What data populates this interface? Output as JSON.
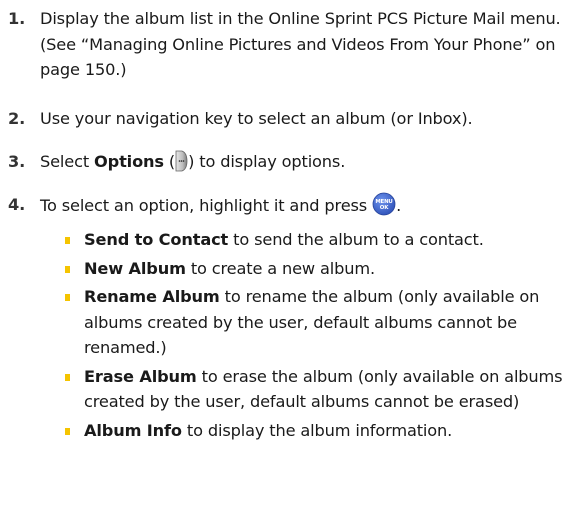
{
  "steps": [
    {
      "number": "1.",
      "text": "Display the album list in the Online Sprint PCS Picture Mail menu. (See “Managing Online Pictures and Videos From Your Phone” on page 150.)"
    },
    {
      "number": "2.",
      "text": "Use your navigation key to select an album (or Inbox)."
    },
    {
      "number": "3.",
      "prefix": "Select ",
      "bold": "Options",
      "middle": " (",
      "icon": "options-softkey-icon",
      "suffix": ") to display options."
    },
    {
      "number": "4.",
      "prefix": "To select an option, highlight it and press ",
      "icon": "menu-ok-key-icon",
      "icon_text_top": "MENU",
      "icon_text_bottom": "OK",
      "suffix": "."
    }
  ],
  "options": [
    {
      "term": "Send to Contact",
      "desc": " to send the album to a contact."
    },
    {
      "term": "New Album",
      "desc": " to create a new album."
    },
    {
      "term": "Rename Album",
      "desc": " to rename the album (only available on albums created by the user, default albums cannot be renamed.)"
    },
    {
      "term": "Erase Album",
      "desc": " to erase the album (only available on albums created by the user, default albums cannot be erased)"
    },
    {
      "term": "Album Info",
      "desc": " to display the album information."
    }
  ],
  "colors": {
    "bullet": "#f5c400",
    "menu_key": "#3a62c9"
  }
}
